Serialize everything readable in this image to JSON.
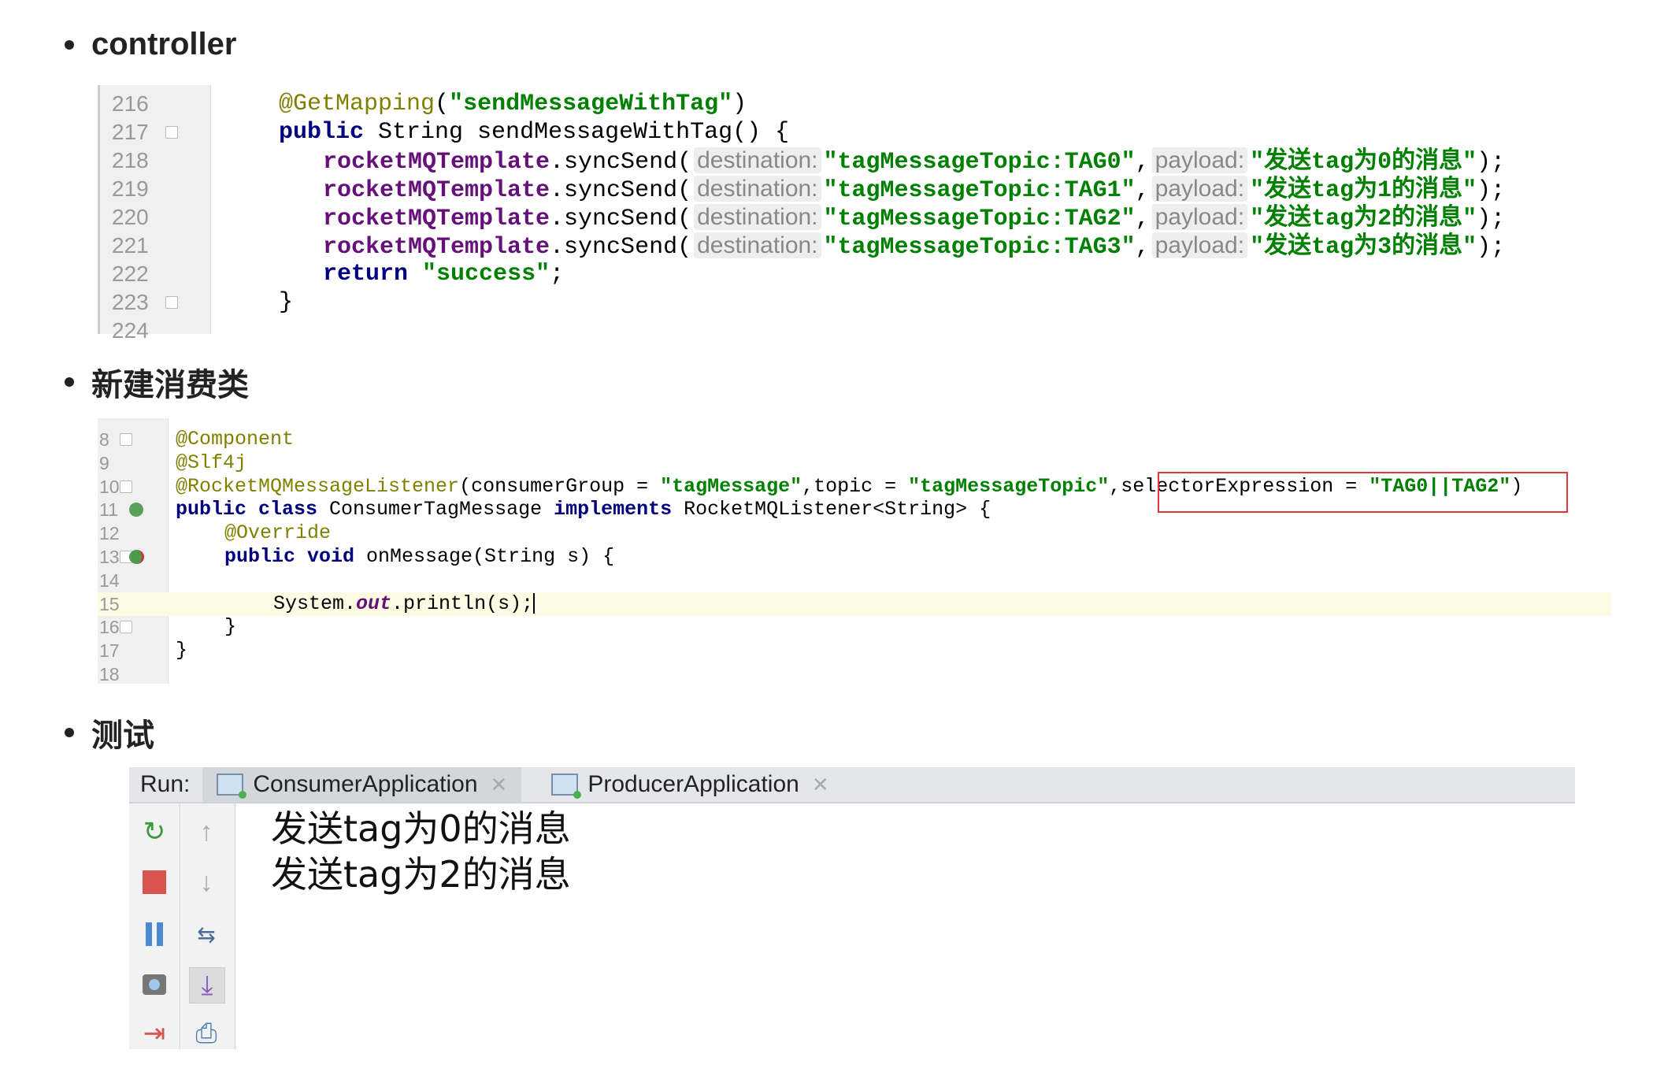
{
  "sections": [
    {
      "heading": "controller"
    },
    {
      "heading": "新建消费类"
    },
    {
      "heading": "测试"
    }
  ],
  "controller_code": {
    "lines": [
      {
        "num": "216",
        "indent": 0,
        "tokens": [
          {
            "t": "ann",
            "v": "@GetMapping"
          },
          {
            "t": "plain",
            "v": "("
          },
          {
            "t": "str",
            "v": "\"sendMessageWithTag\""
          },
          {
            "t": "plain",
            "v": ")"
          }
        ]
      },
      {
        "num": "217",
        "indent": 0,
        "tokens": [
          {
            "t": "kw",
            "v": "public"
          },
          {
            "t": "plain",
            "v": " String sendMessageWithTag() {"
          }
        ]
      },
      {
        "num": "218",
        "indent": 1,
        "tokens": [
          {
            "t": "fld",
            "v": "rocketMQTemplate"
          },
          {
            "t": "plain",
            "v": ".syncSend("
          },
          {
            "t": "hint",
            "v": "destination:"
          },
          {
            "t": "str",
            "v": "\"tagMessageTopic:TAG0\""
          },
          {
            "t": "plain",
            "v": ","
          },
          {
            "t": "hint",
            "v": "payload:"
          },
          {
            "t": "str",
            "v": "\"发送tag为0的消息\""
          },
          {
            "t": "plain",
            "v": ");"
          }
        ]
      },
      {
        "num": "219",
        "indent": 1,
        "tokens": [
          {
            "t": "fld",
            "v": "rocketMQTemplate"
          },
          {
            "t": "plain",
            "v": ".syncSend("
          },
          {
            "t": "hint",
            "v": "destination:"
          },
          {
            "t": "str",
            "v": "\"tagMessageTopic:TAG1\""
          },
          {
            "t": "plain",
            "v": ","
          },
          {
            "t": "hint",
            "v": "payload:"
          },
          {
            "t": "str",
            "v": "\"发送tag为1的消息\""
          },
          {
            "t": "plain",
            "v": ");"
          }
        ]
      },
      {
        "num": "220",
        "indent": 1,
        "tokens": [
          {
            "t": "fld",
            "v": "rocketMQTemplate"
          },
          {
            "t": "plain",
            "v": ".syncSend("
          },
          {
            "t": "hint",
            "v": "destination:"
          },
          {
            "t": "str",
            "v": "\"tagMessageTopic:TAG2\""
          },
          {
            "t": "plain",
            "v": ","
          },
          {
            "t": "hint",
            "v": "payload:"
          },
          {
            "t": "str",
            "v": "\"发送tag为2的消息\""
          },
          {
            "t": "plain",
            "v": ");"
          }
        ]
      },
      {
        "num": "221",
        "indent": 1,
        "tokens": [
          {
            "t": "fld",
            "v": "rocketMQTemplate"
          },
          {
            "t": "plain",
            "v": ".syncSend("
          },
          {
            "t": "hint",
            "v": "destination:"
          },
          {
            "t": "str",
            "v": "\"tagMessageTopic:TAG3\""
          },
          {
            "t": "plain",
            "v": ","
          },
          {
            "t": "hint",
            "v": "payload:"
          },
          {
            "t": "str",
            "v": "\"发送tag为3的消息\""
          },
          {
            "t": "plain",
            "v": ");"
          }
        ]
      },
      {
        "num": "222",
        "indent": 1,
        "tokens": [
          {
            "t": "kw",
            "v": "return"
          },
          {
            "t": "plain",
            "v": " "
          },
          {
            "t": "str",
            "v": "\"success\""
          },
          {
            "t": "plain",
            "v": ";"
          }
        ]
      },
      {
        "num": "223",
        "indent": 0,
        "tokens": [
          {
            "t": "plain",
            "v": "}"
          }
        ]
      },
      {
        "num": "224",
        "indent": 0,
        "tokens": []
      }
    ]
  },
  "consumer_code": {
    "current_line": "15",
    "lines": [
      {
        "num": "8",
        "indent": 0,
        "tokens": [
          {
            "t": "ann",
            "v": "@Component"
          }
        ]
      },
      {
        "num": "9",
        "indent": 0,
        "tokens": [
          {
            "t": "ann",
            "v": "@Slf4j"
          }
        ]
      },
      {
        "num": "10",
        "indent": 0,
        "tokens": [
          {
            "t": "ann",
            "v": "@RocketMQMessageListener"
          },
          {
            "t": "plain",
            "v": "(consumerGroup = "
          },
          {
            "t": "str",
            "v": "\"tagMessage\""
          },
          {
            "t": "plain",
            "v": ",topic = "
          },
          {
            "t": "str",
            "v": "\"tagMessageTopic\""
          },
          {
            "t": "plain",
            "v": ",selectorExpression = "
          },
          {
            "t": "str",
            "v": "\"TAG0||TAG2\""
          },
          {
            "t": "plain",
            "v": ")"
          }
        ]
      },
      {
        "num": "11",
        "indent": 0,
        "tokens": [
          {
            "t": "kw",
            "v": "public class"
          },
          {
            "t": "plain",
            "v": " ConsumerTagMessage "
          },
          {
            "t": "kw",
            "v": "implements"
          },
          {
            "t": "plain",
            "v": " RocketMQListener<String> {"
          }
        ]
      },
      {
        "num": "12",
        "indent": 1,
        "tokens": [
          {
            "t": "ann",
            "v": "@Override"
          }
        ]
      },
      {
        "num": "13",
        "indent": 1,
        "tokens": [
          {
            "t": "kw",
            "v": "public void"
          },
          {
            "t": "plain",
            "v": " onMessage(String s) {"
          }
        ]
      },
      {
        "num": "14",
        "indent": 0,
        "tokens": []
      },
      {
        "num": "15",
        "indent": 2,
        "tokens": [
          {
            "t": "plain",
            "v": "System."
          },
          {
            "t": "out",
            "v": "out"
          },
          {
            "t": "plain",
            "v": ".println(s);"
          }
        ]
      },
      {
        "num": "16",
        "indent": 1,
        "tokens": [
          {
            "t": "plain",
            "v": "}"
          }
        ]
      },
      {
        "num": "17",
        "indent": 0,
        "tokens": [
          {
            "t": "plain",
            "v": "}"
          }
        ]
      },
      {
        "num": "18",
        "indent": 0,
        "tokens": []
      }
    ]
  },
  "run_panel": {
    "label": "Run:",
    "tabs": [
      {
        "label": "ConsumerApplication",
        "active": true
      },
      {
        "label": "ProducerApplication",
        "active": false
      }
    ],
    "toolbar_left": [
      "rerun-icon",
      "stop-icon",
      "pause-icon",
      "screenshot-icon",
      "exit-icon"
    ],
    "toolbar_right": [
      "up-arrow-icon",
      "down-arrow-icon",
      "soft-wrap-icon",
      "scroll-to-end-icon",
      "print-icon"
    ],
    "output": [
      "发送tag为0的消息",
      "发送tag为2的消息"
    ]
  },
  "colors": {
    "annotation": "#808000",
    "keyword": "#000080",
    "string": "#008000",
    "field": "#660e7a",
    "highlight_box": "#e03a3a",
    "current_line": "#fdfbe3"
  }
}
